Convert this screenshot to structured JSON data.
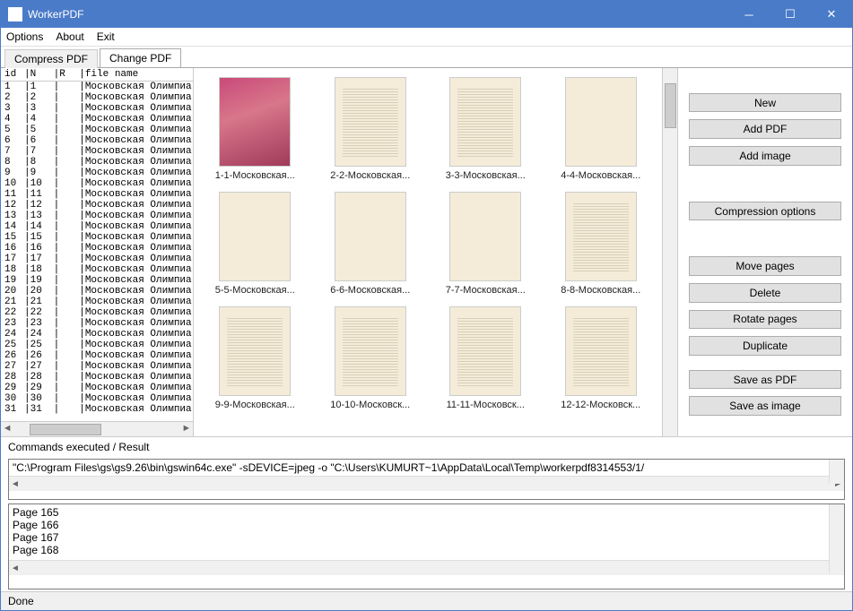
{
  "window": {
    "title": "WorkerPDF"
  },
  "menu": {
    "options": "Options",
    "about": "About",
    "exit": "Exit"
  },
  "tabs": {
    "compress": "Compress PDF",
    "change": "Change PDF"
  },
  "filelist": {
    "header": {
      "id": "id",
      "n": "N",
      "r": "R",
      "file": "file name"
    },
    "rows": [
      {
        "id": "1",
        "n": "1",
        "r": "",
        "file": "Московская Олимпиа"
      },
      {
        "id": "2",
        "n": "2",
        "r": "",
        "file": "Московская Олимпиа"
      },
      {
        "id": "3",
        "n": "3",
        "r": "",
        "file": "Московская Олимпиа"
      },
      {
        "id": "4",
        "n": "4",
        "r": "",
        "file": "Московская Олимпиа"
      },
      {
        "id": "5",
        "n": "5",
        "r": "",
        "file": "Московская Олимпиа"
      },
      {
        "id": "6",
        "n": "6",
        "r": "",
        "file": "Московская Олимпиа"
      },
      {
        "id": "7",
        "n": "7",
        "r": "",
        "file": "Московская Олимпиа"
      },
      {
        "id": "8",
        "n": "8",
        "r": "",
        "file": "Московская Олимпиа"
      },
      {
        "id": "9",
        "n": "9",
        "r": "",
        "file": "Московская Олимпиа"
      },
      {
        "id": "10",
        "n": "10",
        "r": "",
        "file": "Московская Олимпиа"
      },
      {
        "id": "11",
        "n": "11",
        "r": "",
        "file": "Московская Олимпиа"
      },
      {
        "id": "12",
        "n": "12",
        "r": "",
        "file": "Московская Олимпиа"
      },
      {
        "id": "13",
        "n": "13",
        "r": "",
        "file": "Московская Олимпиа"
      },
      {
        "id": "14",
        "n": "14",
        "r": "",
        "file": "Московская Олимпиа"
      },
      {
        "id": "15",
        "n": "15",
        "r": "",
        "file": "Московская Олимпиа"
      },
      {
        "id": "16",
        "n": "16",
        "r": "",
        "file": "Московская Олимпиа"
      },
      {
        "id": "17",
        "n": "17",
        "r": "",
        "file": "Московская Олимпиа"
      },
      {
        "id": "18",
        "n": "18",
        "r": "",
        "file": "Московская Олимпиа"
      },
      {
        "id": "19",
        "n": "19",
        "r": "",
        "file": "Московская Олимпиа"
      },
      {
        "id": "20",
        "n": "20",
        "r": "",
        "file": "Московская Олимпиа"
      },
      {
        "id": "21",
        "n": "21",
        "r": "",
        "file": "Московская Олимпиа"
      },
      {
        "id": "22",
        "n": "22",
        "r": "",
        "file": "Московская Олимпиа"
      },
      {
        "id": "23",
        "n": "23",
        "r": "",
        "file": "Московская Олимпиа"
      },
      {
        "id": "24",
        "n": "24",
        "r": "",
        "file": "Московская Олимпиа"
      },
      {
        "id": "25",
        "n": "25",
        "r": "",
        "file": "Московская Олимпиа"
      },
      {
        "id": "26",
        "n": "26",
        "r": "",
        "file": "Московская Олимпиа"
      },
      {
        "id": "27",
        "n": "27",
        "r": "",
        "file": "Московская Олимпиа"
      },
      {
        "id": "28",
        "n": "28",
        "r": "",
        "file": "Московская Олимпиа"
      },
      {
        "id": "29",
        "n": "29",
        "r": "",
        "file": "Московская Олимпиа"
      },
      {
        "id": "30",
        "n": "30",
        "r": "",
        "file": "Московская Олимпиа"
      },
      {
        "id": "31",
        "n": "31",
        "r": "",
        "file": "Московская Олимпиа"
      }
    ]
  },
  "thumbs": [
    {
      "label": "1-1-Московская...",
      "style": "cover"
    },
    {
      "label": "2-2-Московская...",
      "style": "lines"
    },
    {
      "label": "3-3-Московская...",
      "style": "lines"
    },
    {
      "label": "4-4-Московская...",
      "style": ""
    },
    {
      "label": "5-5-Московская...",
      "style": ""
    },
    {
      "label": "6-6-Московская...",
      "style": ""
    },
    {
      "label": "7-7-Московская...",
      "style": ""
    },
    {
      "label": "8-8-Московская...",
      "style": "lines"
    },
    {
      "label": "9-9-Московская...",
      "style": "lines"
    },
    {
      "label": "10-10-Московск...",
      "style": "lines"
    },
    {
      "label": "11-11-Московск...",
      "style": "lines"
    },
    {
      "label": "12-12-Московск...",
      "style": "lines"
    }
  ],
  "sidebar": {
    "new": "New",
    "addpdf": "Add PDF",
    "addimage": "Add image",
    "compression": "Compression options",
    "movepages": "Move pages",
    "delete": "Delete",
    "rotate": "Rotate pages",
    "duplicate": "Duplicate",
    "savepdf": "Save as PDF",
    "saveimage": "Save as image"
  },
  "commands": {
    "label": "Commands executed / Result",
    "cmd": "\"C:\\Program Files\\gs\\gs9.26\\bin\\gswin64c.exe\" -sDEVICE=jpeg -o \"C:\\Users\\KUMURT~1\\AppData\\Local\\Temp\\workerpdf8314553/1/",
    "result": "Page 165\nPage 166\nPage 167\nPage 168"
  },
  "status": "Done"
}
